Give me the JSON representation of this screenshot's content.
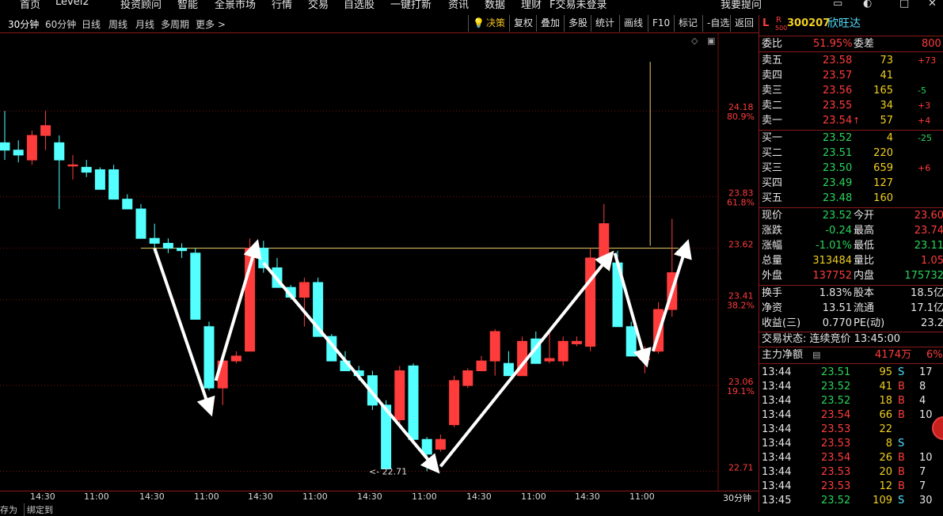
{
  "top_menu": [
    "首页",
    "Level2",
    "投资顾问",
    "智能",
    "全景市场",
    "行情",
    "交易",
    "自选股",
    "一键打新",
    "资讯",
    "数据",
    "理财",
    "F交易未登录",
    "我要提问"
  ],
  "toolbar": {
    "periods": [
      "30分钟",
      "60分钟",
      "日线",
      "周线",
      "月线",
      "多周期",
      "更多 >"
    ],
    "buttons": [
      "决策",
      "复权",
      "叠加",
      "多股",
      "统计",
      "画线",
      "F10",
      "标记",
      "-自选",
      "返回"
    ]
  },
  "chart": {
    "price_labels": [
      {
        "price": "24.18",
        "pct": "80.9%"
      },
      {
        "price": "23.83",
        "pct": "61.8%"
      },
      {
        "price": "23.62",
        "pct": ""
      },
      {
        "price": "23.41",
        "pct": "38.2%"
      },
      {
        "price": "23.06",
        "pct": "19.1%"
      },
      {
        "price": "22.71",
        "pct": ""
      }
    ],
    "low_annotation": "22.71",
    "time_labels": [
      "14:30",
      "11:00",
      "14:30",
      "11:00",
      "14:30",
      "11:00",
      "14:30",
      "11:00",
      "14:30",
      "11:00",
      "14:30",
      "11:00"
    ],
    "period_label": "30分钟",
    "bottom_tabs": [
      "存为",
      "绑定到"
    ],
    "colors": {
      "up": "#ff3c3c",
      "down": "#54ffff",
      "grid": "#7a1010",
      "level_line": "#e8d060",
      "arrow": "#ffffff"
    }
  },
  "chart_data": {
    "type": "candlestick",
    "ylim": [
      22.66,
      24.5
    ],
    "candles": [
      {
        "o": 24.05,
        "h": 24.18,
        "l": 23.98,
        "c": 24.02
      },
      {
        "o": 24.02,
        "h": 24.06,
        "l": 23.97,
        "c": 24.0
      },
      {
        "o": 23.98,
        "h": 24.1,
        "l": 23.96,
        "c": 24.08
      },
      {
        "o": 24.08,
        "h": 24.18,
        "l": 24.02,
        "c": 24.12
      },
      {
        "o": 24.05,
        "h": 24.08,
        "l": 23.78,
        "c": 23.98
      },
      {
        "o": 23.96,
        "h": 24.0,
        "l": 23.9,
        "c": 23.96
      },
      {
        "o": 23.95,
        "h": 23.98,
        "l": 23.91,
        "c": 23.93
      },
      {
        "o": 23.94,
        "h": 23.95,
        "l": 23.86,
        "c": 23.86
      },
      {
        "o": 23.94,
        "h": 23.96,
        "l": 23.82,
        "c": 23.82
      },
      {
        "o": 23.82,
        "h": 23.84,
        "l": 23.78,
        "c": 23.78
      },
      {
        "o": 23.78,
        "h": 23.8,
        "l": 23.66,
        "c": 23.66
      },
      {
        "o": 23.66,
        "h": 23.72,
        "l": 23.6,
        "c": 23.64
      },
      {
        "o": 23.64,
        "h": 23.66,
        "l": 23.6,
        "c": 23.62
      },
      {
        "o": 23.62,
        "h": 23.64,
        "l": 23.58,
        "c": 23.61
      },
      {
        "o": 23.6,
        "h": 23.62,
        "l": 23.33,
        "c": 23.33
      },
      {
        "o": 23.3,
        "h": 23.32,
        "l": 23.04,
        "c": 23.05
      },
      {
        "o": 23.05,
        "h": 23.18,
        "l": 22.98,
        "c": 23.16
      },
      {
        "o": 23.16,
        "h": 23.2,
        "l": 23.15,
        "c": 23.18
      },
      {
        "o": 23.2,
        "h": 23.66,
        "l": 23.2,
        "c": 23.62
      },
      {
        "o": 23.62,
        "h": 23.65,
        "l": 23.52,
        "c": 23.54
      },
      {
        "o": 23.54,
        "h": 23.58,
        "l": 23.46,
        "c": 23.46
      },
      {
        "o": 23.46,
        "h": 23.47,
        "l": 23.41,
        "c": 23.42
      },
      {
        "o": 23.42,
        "h": 23.5,
        "l": 23.3,
        "c": 23.48
      },
      {
        "o": 23.48,
        "h": 23.5,
        "l": 23.26,
        "c": 23.26
      },
      {
        "o": 23.26,
        "h": 23.27,
        "l": 23.16,
        "c": 23.16
      },
      {
        "o": 23.16,
        "h": 23.2,
        "l": 23.12,
        "c": 23.12
      },
      {
        "o": 23.12,
        "h": 23.14,
        "l": 23.08,
        "c": 23.1
      },
      {
        "o": 23.1,
        "h": 23.12,
        "l": 22.96,
        "c": 22.98
      },
      {
        "o": 22.98,
        "h": 23.0,
        "l": 22.72,
        "c": 22.72
      },
      {
        "o": 22.92,
        "h": 23.14,
        "l": 22.9,
        "c": 23.12
      },
      {
        "o": 23.14,
        "h": 23.15,
        "l": 22.83,
        "c": 22.84
      },
      {
        "o": 22.84,
        "h": 22.85,
        "l": 22.71,
        "c": 22.78
      },
      {
        "o": 22.8,
        "h": 22.86,
        "l": 22.79,
        "c": 22.84
      },
      {
        "o": 22.9,
        "h": 23.1,
        "l": 22.89,
        "c": 23.08
      },
      {
        "o": 23.06,
        "h": 23.13,
        "l": 23.05,
        "c": 23.12
      },
      {
        "o": 23.12,
        "h": 23.18,
        "l": 23.12,
        "c": 23.16
      },
      {
        "o": 23.16,
        "h": 23.29,
        "l": 23.1,
        "c": 23.28
      },
      {
        "o": 23.15,
        "h": 23.2,
        "l": 23.1,
        "c": 23.1
      },
      {
        "o": 23.1,
        "h": 23.26,
        "l": 23.1,
        "c": 23.24
      },
      {
        "o": 23.25,
        "h": 23.28,
        "l": 23.15,
        "c": 23.15
      },
      {
        "o": 23.16,
        "h": 23.28,
        "l": 23.15,
        "c": 23.17
      },
      {
        "o": 23.16,
        "h": 23.26,
        "l": 23.14,
        "c": 23.24
      },
      {
        "o": 23.23,
        "h": 23.26,
        "l": 23.22,
        "c": 23.24
      },
      {
        "o": 23.22,
        "h": 23.62,
        "l": 23.2,
        "c": 23.58
      },
      {
        "o": 23.58,
        "h": 23.8,
        "l": 23.56,
        "c": 23.72
      },
      {
        "o": 23.56,
        "h": 23.61,
        "l": 23.3,
        "c": 23.3
      },
      {
        "o": 23.3,
        "h": 23.32,
        "l": 23.18,
        "c": 23.18
      },
      {
        "o": 23.17,
        "h": 23.22,
        "l": 23.11,
        "c": 23.17
      },
      {
        "o": 23.2,
        "h": 23.4,
        "l": 23.19,
        "c": 23.37
      },
      {
        "o": 23.37,
        "h": 23.74,
        "l": 23.34,
        "c": 23.52
      }
    ],
    "level_line": 23.62,
    "spike": {
      "index": 46,
      "top": 24.38,
      "bottom": 23.63
    },
    "arrows": [
      {
        "from": [
          11,
          23.62
        ],
        "to": [
          15,
          22.97
        ]
      },
      {
        "from": [
          15.5,
          23.08
        ],
        "to": [
          18.4,
          23.62
        ]
      },
      {
        "from": [
          19,
          23.56
        ],
        "to": [
          31.5,
          22.73
        ]
      },
      {
        "from": [
          32,
          22.73
        ],
        "to": [
          44.3,
          23.58
        ]
      },
      {
        "from": [
          44.8,
          23.6
        ],
        "to": [
          47,
          23.17
        ]
      },
      {
        "from": [
          47.6,
          23.2
        ],
        "to": [
          50,
          23.62
        ]
      }
    ]
  },
  "panel": {
    "header": {
      "badge_l": "L",
      "badge_r": "R",
      "badge_sub": "500",
      "code": "300207",
      "name": "欣旺达"
    },
    "weibi": {
      "label": "委比",
      "value": "51.95%",
      "label2": "委差",
      "value2": "800"
    },
    "sells": [
      {
        "label": "卖五",
        "price": "23.58",
        "vol": "73",
        "chg": "+73"
      },
      {
        "label": "卖四",
        "price": "23.57",
        "vol": "41",
        "chg": ""
      },
      {
        "label": "卖三",
        "price": "23.56",
        "vol": "165",
        "chg": "-5"
      },
      {
        "label": "卖二",
        "price": "23.55",
        "vol": "34",
        "chg": "+3"
      },
      {
        "label": "卖一",
        "price": "23.54",
        "vol": "57",
        "chg": "+4"
      }
    ],
    "buys": [
      {
        "label": "买一",
        "price": "23.52",
        "vol": "4",
        "chg": "-25"
      },
      {
        "label": "买二",
        "price": "23.51",
        "vol": "220",
        "chg": ""
      },
      {
        "label": "买三",
        "price": "23.50",
        "vol": "659",
        "chg": "+6"
      },
      {
        "label": "买四",
        "price": "23.49",
        "vol": "127",
        "chg": ""
      },
      {
        "label": "买五",
        "price": "23.48",
        "vol": "160",
        "chg": ""
      }
    ],
    "stats": [
      {
        "l1": "现价",
        "v1": "23.52",
        "l2": "今开",
        "v2": "23.60"
      },
      {
        "l1": "涨跌",
        "v1": "-0.24",
        "l2": "最高",
        "v2": "23.74"
      },
      {
        "l1": "涨幅",
        "v1": "-1.01%",
        "l2": "最低",
        "v2": "23.11"
      },
      {
        "l1": "总量",
        "v1": "313484",
        "l2": "量比",
        "v2": "1.05"
      },
      {
        "l1": "外盘",
        "v1": "137752",
        "l2": "内盘",
        "v2": "175732"
      }
    ],
    "stats2": [
      {
        "l1": "换手",
        "v1": "1.83%",
        "l2": "股本",
        "v2": "18.5亿"
      },
      {
        "l1": "净资",
        "v1": "13.51",
        "l2": "流通",
        "v2": "17.1亿"
      },
      {
        "l1": "收益(三)",
        "v1": "0.770",
        "l2": "PE(动)",
        "v2": "23.2"
      }
    ],
    "trade_status": "交易状态: 连续竞价 13:45:00",
    "main_net": {
      "label": "主力净额",
      "value": "4174万",
      "pct": "6%"
    },
    "ticks": [
      {
        "t": "13:44",
        "p": "23.51",
        "v": "95",
        "s": "S",
        "x": "17"
      },
      {
        "t": "13:44",
        "p": "23.52",
        "v": "41",
        "s": "B",
        "x": "8"
      },
      {
        "t": "13:44",
        "p": "23.52",
        "v": "18",
        "s": "B",
        "x": "4"
      },
      {
        "t": "13:44",
        "p": "23.54",
        "v": "66",
        "s": "B",
        "x": "10"
      },
      {
        "t": "13:44",
        "p": "23.53",
        "v": "22",
        "s": "",
        "x": ""
      },
      {
        "t": "13:44",
        "p": "23.53",
        "v": "8",
        "s": "S",
        "x": ""
      },
      {
        "t": "13:44",
        "p": "23.54",
        "v": "26",
        "s": "B",
        "x": "10"
      },
      {
        "t": "13:44",
        "p": "23.53",
        "v": "20",
        "s": "B",
        "x": "7"
      },
      {
        "t": "13:44",
        "p": "23.53",
        "v": "12",
        "s": "B",
        "x": "7"
      },
      {
        "t": "13:45",
        "p": "23.52",
        "v": "109",
        "s": "S",
        "x": "30"
      }
    ]
  }
}
